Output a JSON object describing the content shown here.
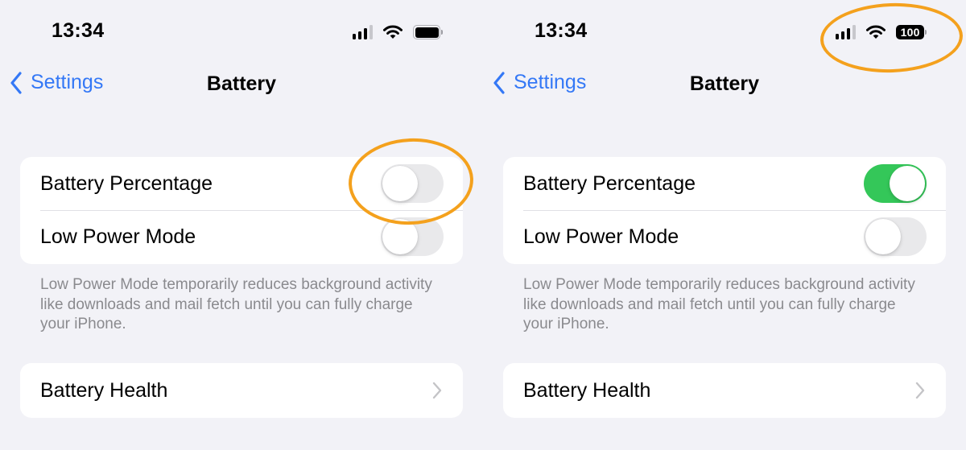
{
  "highlight_color": "#f4a11d",
  "accent_color": "#3478f6",
  "toggle_on_color": "#34c759",
  "panels": [
    {
      "status_bar": {
        "time": "13:34",
        "signal_bars_active": 3,
        "signal_bars_total": 4,
        "wifi_icon": "wifi-icon",
        "battery_display": "icon",
        "battery_percent_text": ""
      },
      "nav": {
        "back_label": "Settings",
        "title": "Battery"
      },
      "settings": [
        {
          "label": "Battery Percentage",
          "toggle_on": false,
          "highlighted": true
        },
        {
          "label": "Low Power Mode",
          "toggle_on": false,
          "highlighted": false
        }
      ],
      "footer_text": "Low Power Mode temporarily reduces background activity like downloads and mail fetch until you can fully charge your iPhone.",
      "health_row": {
        "label": "Battery Health",
        "icon": "chevron-right-icon"
      }
    },
    {
      "status_bar": {
        "time": "13:34",
        "signal_bars_active": 3,
        "signal_bars_total": 4,
        "wifi_icon": "wifi-icon",
        "battery_display": "percentage",
        "battery_percent_text": "100",
        "highlighted": true
      },
      "nav": {
        "back_label": "Settings",
        "title": "Battery"
      },
      "settings": [
        {
          "label": "Battery Percentage",
          "toggle_on": true,
          "highlighted": false
        },
        {
          "label": "Low Power Mode",
          "toggle_on": false,
          "highlighted": false
        }
      ],
      "footer_text": "Low Power Mode temporarily reduces background activity like downloads and mail fetch until you can fully charge your iPhone.",
      "health_row": {
        "label": "Battery Health",
        "icon": "chevron-right-icon"
      }
    }
  ]
}
